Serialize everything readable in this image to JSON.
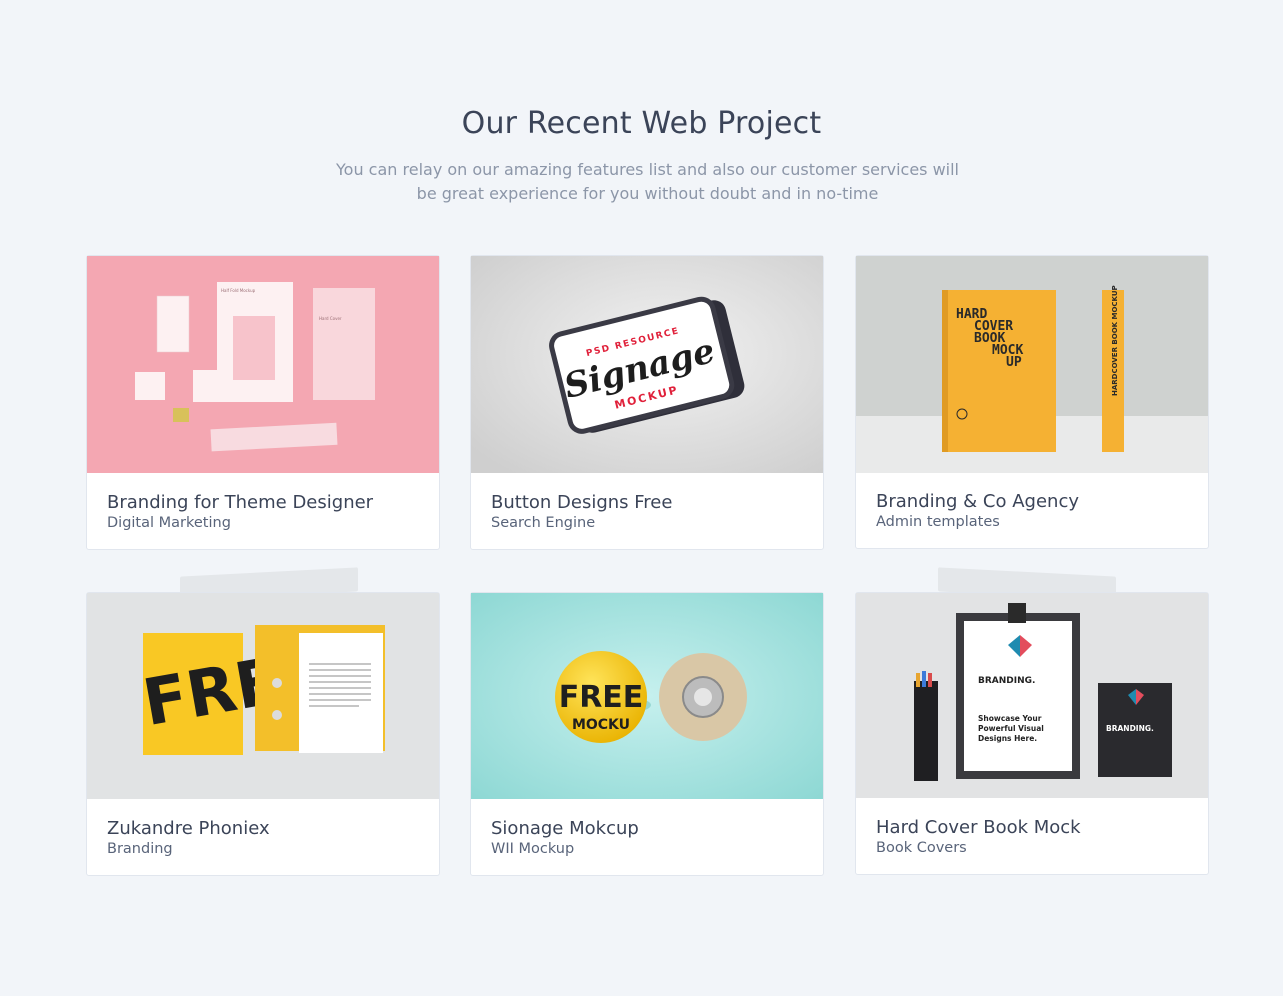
{
  "section": {
    "title": "Our Recent Web Project",
    "subtitle_line1": "You can relay on our amazing features list and also our customer services will",
    "subtitle_line2": "be great experience for you without doubt and in no-time"
  },
  "projects": [
    {
      "title": "Branding for Theme Designer",
      "category": "Digital Marketing",
      "image": "stationery-mockup-pink"
    },
    {
      "title": "Button Designs Free",
      "category": "Search Engine",
      "image": "signage-mockup"
    },
    {
      "title": "Branding & Co Agency",
      "category": "Admin templates",
      "image": "hardcover-book-mockup-yellow"
    },
    {
      "title": "Zukandre Phoniex",
      "category": "Branding",
      "image": "folder-letterhead-mockup"
    },
    {
      "title": "Sionage Mokcup",
      "category": "WII Mockup",
      "image": "pin-button-mockup"
    },
    {
      "title": "Hard Cover Book Mock",
      "category": "Book Covers",
      "image": "clipboard-branding-mockup"
    }
  ],
  "image_text": {
    "signage_top": "PSD RESOURCE",
    "signage_main": "Signage",
    "signage_bottom": "MOCKUP",
    "book_l1": "HARD",
    "book_l2": "COVER",
    "book_l3": "BOOK",
    "book_l4": "MOCK",
    "book_l5": "UP",
    "book_spine": "HARDCOVER BOOK MOCKUP",
    "folder_big": "FREE",
    "pin_text": "FREE",
    "pin_sub": "MOCKU",
    "clip_heading": "BRANDING.",
    "clip_body1": "Showcase Your",
    "clip_body2": "Powerful Visual",
    "clip_body3": "Designs Here.",
    "clip_book": "BRANDING."
  },
  "colors": {
    "background": "#f2f5f9",
    "title": "#3b4458",
    "subtitle": "#8c96a8"
  }
}
